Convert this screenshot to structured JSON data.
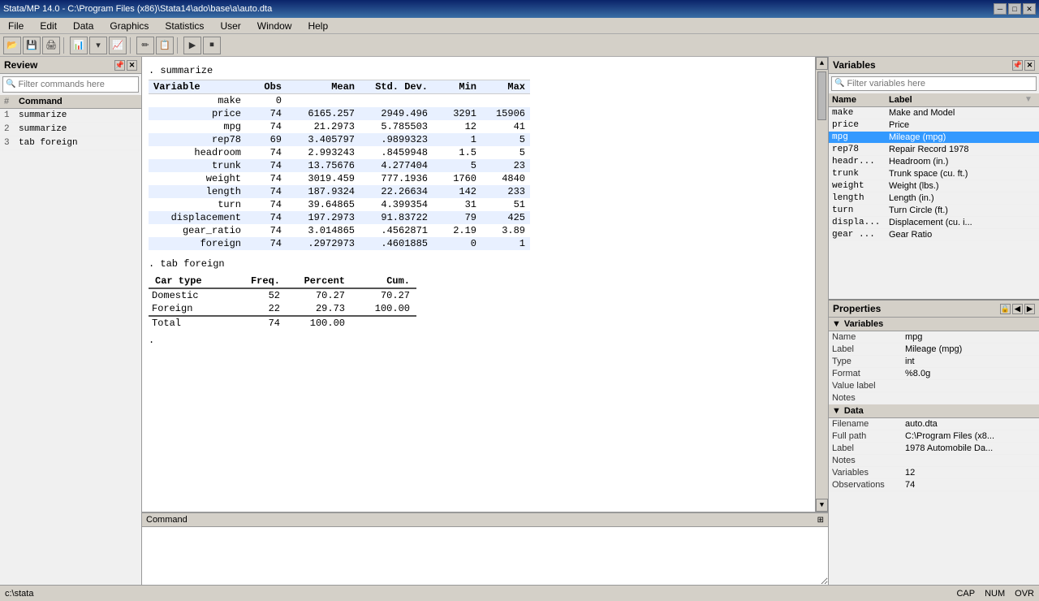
{
  "titleBar": {
    "title": "Stata/MP 14.0 - C:\\Program Files (x86)\\Stata14\\ado\\base\\a\\auto.dta",
    "minBtn": "─",
    "maxBtn": "□",
    "closeBtn": "✕"
  },
  "menuBar": {
    "items": [
      "File",
      "Edit",
      "Data",
      "Graphics",
      "Statistics",
      "User",
      "Window",
      "Help"
    ]
  },
  "reviewPanel": {
    "title": "Review",
    "filterPlaceholder": "Filter commands here",
    "columns": {
      "hash": "#",
      "command": "Command"
    },
    "rows": [
      {
        "num": "1",
        "cmd": "summarize"
      },
      {
        "num": "2",
        "cmd": "summarize"
      },
      {
        "num": "3",
        "cmd": "tab foreign"
      }
    ]
  },
  "summarizeTable": {
    "cmdLine": ". summarize",
    "headers": [
      "Variable",
      "Obs",
      "Mean",
      "Std. Dev.",
      "Min",
      "Max"
    ],
    "rows": [
      {
        "var": "make",
        "obs": "0",
        "mean": "",
        "std": "",
        "min": "",
        "max": "",
        "alt": false
      },
      {
        "var": "price",
        "obs": "74",
        "mean": "6165.257",
        "std": "2949.496",
        "min": "3291",
        "max": "15906",
        "alt": true
      },
      {
        "var": "mpg",
        "obs": "74",
        "mean": "21.2973",
        "std": "5.785503",
        "min": "12",
        "max": "41",
        "alt": false
      },
      {
        "var": "rep78",
        "obs": "69",
        "mean": "3.405797",
        "std": ".9899323",
        "min": "1",
        "max": "5",
        "alt": true
      },
      {
        "var": "headroom",
        "obs": "74",
        "mean": "2.993243",
        "std": ".8459948",
        "min": "1.5",
        "max": "5",
        "alt": false
      },
      {
        "var": "trunk",
        "obs": "74",
        "mean": "13.75676",
        "std": "4.277404",
        "min": "5",
        "max": "23",
        "alt": true
      },
      {
        "var": "weight",
        "obs": "74",
        "mean": "3019.459",
        "std": "777.1936",
        "min": "1760",
        "max": "4840",
        "alt": false
      },
      {
        "var": "length",
        "obs": "74",
        "mean": "187.9324",
        "std": "22.26634",
        "min": "142",
        "max": "233",
        "alt": true
      },
      {
        "var": "turn",
        "obs": "74",
        "mean": "39.64865",
        "std": "4.399354",
        "min": "31",
        "max": "51",
        "alt": false
      },
      {
        "var": "displacement",
        "obs": "74",
        "mean": "197.2973",
        "std": "91.83722",
        "min": "79",
        "max": "425",
        "alt": true
      },
      {
        "var": "gear_ratio",
        "obs": "74",
        "mean": "3.014865",
        "std": ".4562871",
        "min": "2.19",
        "max": "3.89",
        "alt": false
      },
      {
        "var": "foreign",
        "obs": "74",
        "mean": ".2972973",
        "std": ".4601885",
        "min": "0",
        "max": "1",
        "alt": true
      }
    ]
  },
  "tabForeignCmd": ". tab foreign",
  "tabForeignTable": {
    "headers": [
      "Car type",
      "Freq.",
      "Percent",
      "Cum."
    ],
    "rows": [
      {
        "type": "Domestic",
        "freq": "52",
        "pct": "70.27",
        "cum": "70.27"
      },
      {
        "type": "Foreign",
        "freq": "22",
        "pct": "29.73",
        "cum": "100.00"
      }
    ],
    "total": {
      "label": "Total",
      "freq": "74",
      "pct": "100.00",
      "cum": ""
    }
  },
  "commandBar": {
    "label": "Command"
  },
  "statusBar": {
    "left": "c:\\stata",
    "caps": "CAP",
    "num": "NUM",
    "ovr": "OVR"
  },
  "variablesPanel": {
    "title": "Variables",
    "filterPlaceholder": "Filter variables here",
    "columns": {
      "name": "Name",
      "label": "Label"
    },
    "rows": [
      {
        "name": "make",
        "label": "Make and Model",
        "selected": false
      },
      {
        "name": "price",
        "label": "Price",
        "selected": false
      },
      {
        "name": "mpg",
        "label": "Mileage (mpg)",
        "selected": true
      },
      {
        "name": "rep78",
        "label": "Repair Record 1978",
        "selected": false
      },
      {
        "name": "headr...",
        "label": "Headroom (in.)",
        "selected": false
      },
      {
        "name": "trunk",
        "label": "Trunk space (cu. ft.)",
        "selected": false
      },
      {
        "name": "weight",
        "label": "Weight (lbs.)",
        "selected": false
      },
      {
        "name": "length",
        "label": "Length (in.)",
        "selected": false
      },
      {
        "name": "turn",
        "label": "Turn Circle (ft.)",
        "selected": false
      },
      {
        "name": "displa...",
        "label": "Displacement (cu. i...",
        "selected": false
      },
      {
        "name": "gear ...",
        "label": "Gear Ratio",
        "selected": false
      }
    ]
  },
  "propertiesPanel": {
    "title": "Properties",
    "variables": {
      "sectionLabel": "Variables",
      "rows": [
        {
          "key": "Name",
          "val": "mpg"
        },
        {
          "key": "Label",
          "val": "Mileage (mpg)"
        },
        {
          "key": "Type",
          "val": "int"
        },
        {
          "key": "Format",
          "val": "%8.0g"
        },
        {
          "key": "Value label",
          "val": ""
        },
        {
          "key": "Notes",
          "val": ""
        }
      ]
    },
    "data": {
      "sectionLabel": "Data",
      "rows": [
        {
          "key": "Filename",
          "val": "auto.dta"
        },
        {
          "key": "Full path",
          "val": "C:\\Program Files (x8..."
        },
        {
          "key": "Label",
          "val": "1978 Automobile Da..."
        },
        {
          "key": "Notes",
          "val": ""
        },
        {
          "key": "Variables",
          "val": "12"
        },
        {
          "key": "Observations",
          "val": "74"
        }
      ]
    }
  }
}
